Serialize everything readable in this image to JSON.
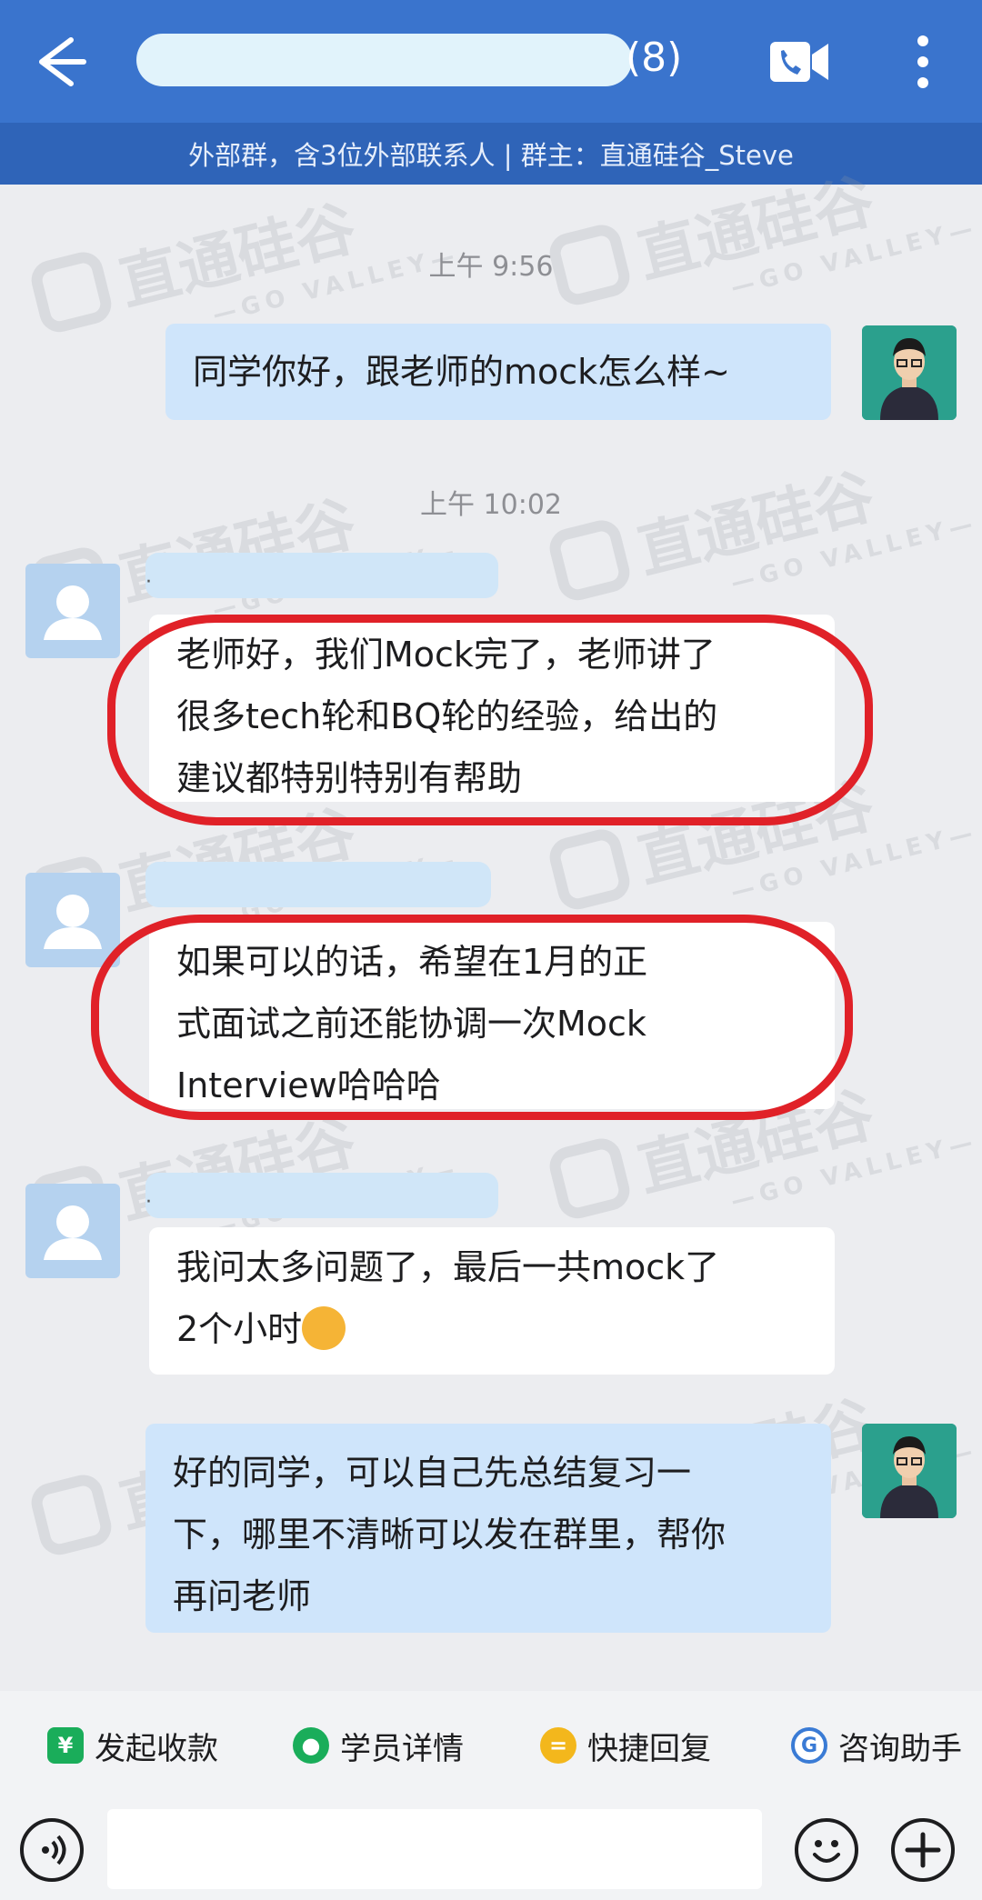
{
  "header": {
    "title_suffix": "(8)",
    "subtitle": "外部群，含3位外部联系人 | 群主：直通硅谷_Steve",
    "back_icon": "back-arrow-icon",
    "video_icon": "video-call-icon",
    "more_icon": "more-vertical-icon",
    "colors": {
      "header_bg": "#3a74cd",
      "subheader_bg": "#2f64b8"
    }
  },
  "watermark": {
    "text": "直通硅谷",
    "sub": "—GO VALLEY—"
  },
  "messages": [
    {
      "type": "timestamp",
      "text": "上午 9:56"
    },
    {
      "type": "outgoing",
      "text": "同学你好，跟老师的mock怎么样~"
    },
    {
      "type": "timestamp",
      "text": "上午 10:02"
    },
    {
      "type": "incoming",
      "name": "·",
      "lines": [
        "老师好，我们Mock完了，老师讲了",
        "很多tech轮和BQ轮的经验，给出的",
        "建议都特别特别有帮助"
      ]
    },
    {
      "type": "incoming",
      "name": "",
      "lines": [
        "如果可以的话，希望在1月的正",
        "式面试之前还能协调一次Mock",
        "Interview哈哈哈"
      ]
    },
    {
      "type": "incoming",
      "name": "·",
      "lines": [
        "我问太多问题了，最后一共mock了",
        "2个小时"
      ],
      "emoji": "face-with-tears-of-joy"
    },
    {
      "type": "outgoing",
      "lines": [
        "好的同学，可以自己先总结复习一",
        "下，哪里不清晰可以发在群里，帮你",
        "再问老师"
      ]
    }
  ],
  "quick_actions": [
    {
      "label": "发起收款",
      "icon": "payment-icon",
      "color": "#1aad5a"
    },
    {
      "label": "学员详情",
      "icon": "contact-icon",
      "color": "#1aad5a"
    },
    {
      "label": "快捷回复",
      "icon": "quick-reply-icon",
      "color": "#f3b71c"
    },
    {
      "label": "咨询助手",
      "icon": "assistant-icon",
      "color": "#3a7bd5"
    }
  ],
  "input_bar": {
    "voice_icon": "voice-icon",
    "emoji_icon": "emoji-icon",
    "plus_icon": "plus-icon",
    "placeholder": ""
  }
}
